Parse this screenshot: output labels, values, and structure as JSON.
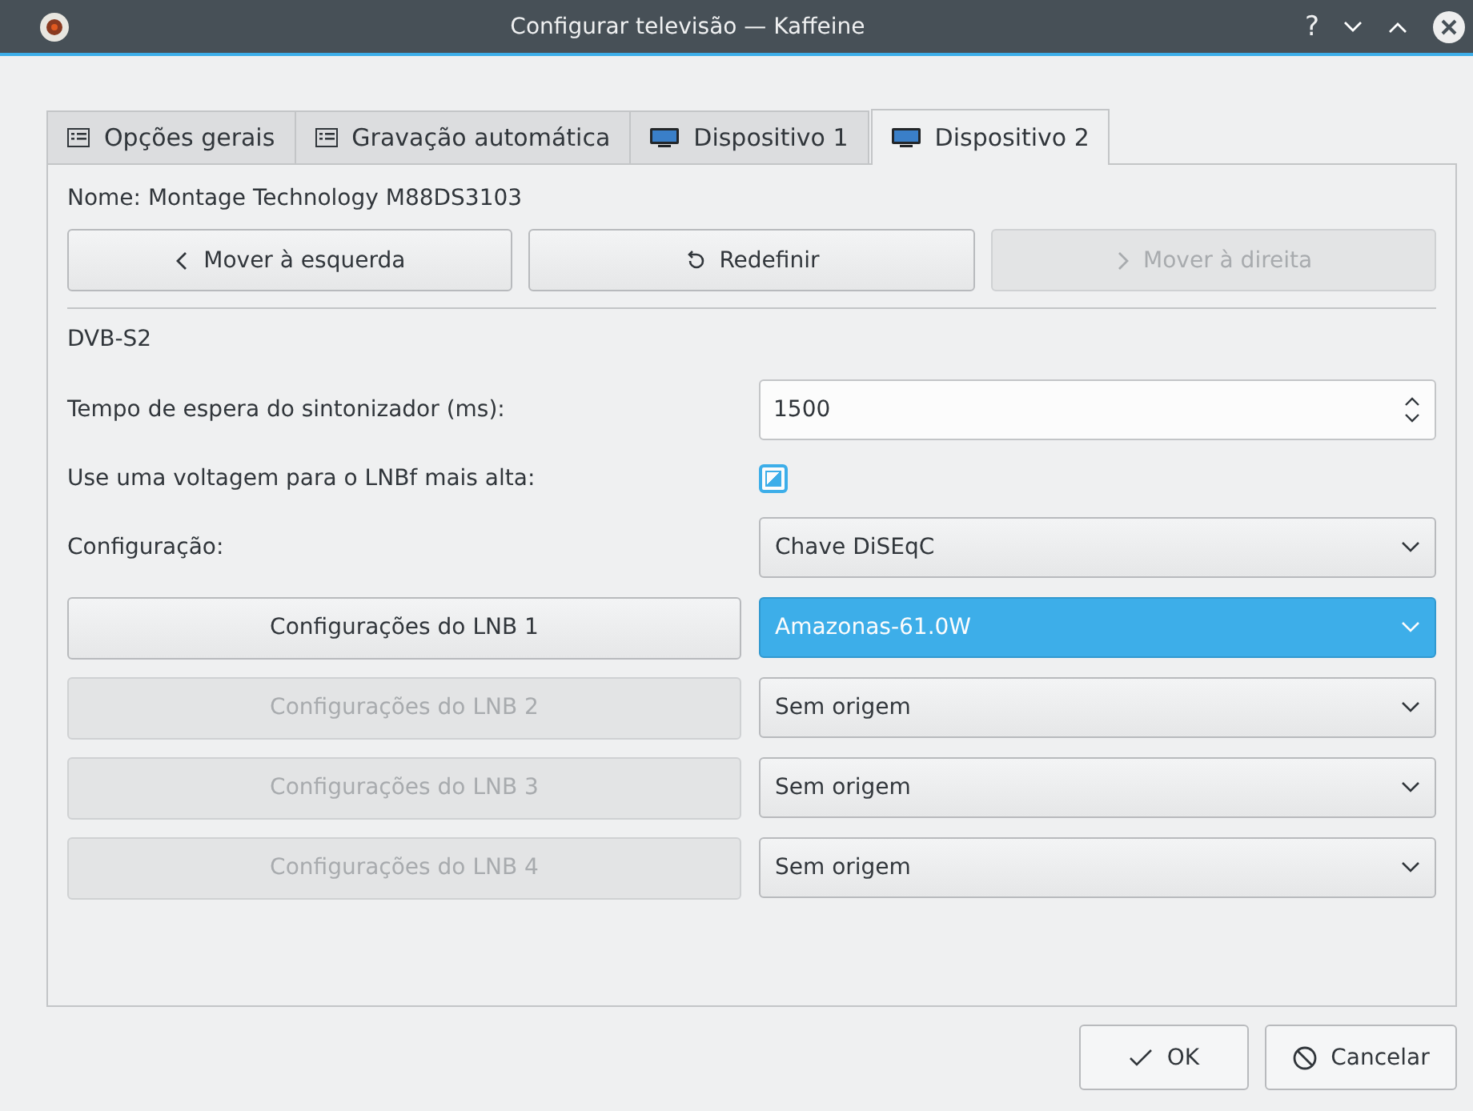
{
  "window": {
    "title": "Configurar televisão — Kaffeine",
    "controls": [
      "?"
    ]
  },
  "tabs": [
    {
      "label": "Opções gerais",
      "kind": "list",
      "selected": false
    },
    {
      "label": "Gravação automática",
      "kind": "list",
      "selected": false
    },
    {
      "label": "Dispositivo 1",
      "kind": "screen",
      "selected": false
    },
    {
      "label": "Dispositivo 2",
      "kind": "screen",
      "selected": true
    }
  ],
  "device_name": "Nome: Montage Technology M88DS3103",
  "move_buttons": [
    {
      "label": "Mover à esquerda",
      "kind": "left",
      "disabled": false
    },
    {
      "label": "Redefinir",
      "kind": "reset",
      "disabled": false
    },
    {
      "label": "Mover à direita",
      "kind": "right",
      "disabled": true
    }
  ],
  "section": "DVB-S2",
  "timeout": {
    "label": "Tempo de espera do sintonizador (ms):",
    "value": "1500"
  },
  "high_voltage": {
    "label": "Use uma voltagem para o LNBf mais alta:",
    "checked": true
  },
  "configuration": {
    "label": "Configuração:",
    "value": "Chave DiSEqC"
  },
  "lnbs": [
    {
      "button": "Configurações do LNB 1",
      "disabled": false,
      "source": "Amazonas-61.0W",
      "selected": true
    },
    {
      "button": "Configurações do LNB 2",
      "disabled": true,
      "source": "Sem origem",
      "selected": false
    },
    {
      "button": "Configurações do LNB 3",
      "disabled": true,
      "source": "Sem origem",
      "selected": false
    },
    {
      "button": "Configurações do LNB 4",
      "disabled": true,
      "source": "Sem origem",
      "selected": false
    }
  ],
  "buttons": [
    {
      "label": "OK",
      "kind": "ok"
    },
    {
      "label": "Cancelar",
      "kind": "cancel"
    }
  ]
}
